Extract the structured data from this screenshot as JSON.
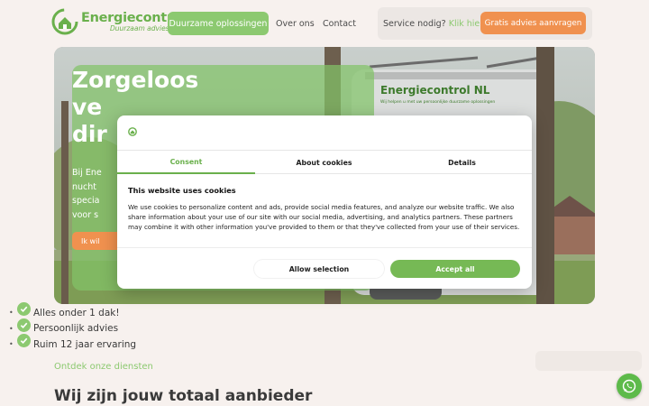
{
  "header": {
    "logo": {
      "name": "Energiecontrol",
      "tagline": "Duurzaam advies"
    },
    "nav": [
      {
        "label": "Duurzame oplossingen",
        "active": true
      },
      {
        "label": "Over ons"
      },
      {
        "label": "Contact"
      }
    ],
    "service": {
      "text": "Service nodig?",
      "link": "Klik hier"
    },
    "cta": "Gratis advies aanvragen"
  },
  "hero": {
    "title_lines": [
      "Zorgeloos",
      "ve",
      "dir"
    ],
    "text_lines": [
      "Bij Ene",
      "nucht",
      "specia",
      "voor s"
    ],
    "button": "Ik wil",
    "van_brand": "Energiecontrol NL",
    "van_slogan": "Wij helpen u met uw persoonlijke duurzame oplossingen"
  },
  "usps": [
    "Alles onder 1 dak!",
    "Persoonlijk advies",
    "Ruim 12 jaar ervaring"
  ],
  "services_link": "Ontdek onze diensten",
  "section_title": "Wij zijn jouw totaal aanbieder",
  "cookie_dialog": {
    "tabs": [
      "Consent",
      "About cookies",
      "Details"
    ],
    "active_tab": "Consent",
    "title": "This website uses cookies",
    "body": "We use cookies to personalize content and ads, provide social media features, and analyze our website traffic. We also share information about your use of our site with our social media, advertising, and analytics partners. These partners may combine it with other information you've provided to them or that they've collected from your use of their services.",
    "allow_selection": "Allow selection",
    "accept_all": "Accept all"
  },
  "floating": {
    "whatsapp_icon": "whatsapp-icon"
  },
  "colors": {
    "brand_green": "#6ab04c",
    "light_green": "#8cc970",
    "orange": "#f0914f",
    "background": "#f7f1ee"
  }
}
